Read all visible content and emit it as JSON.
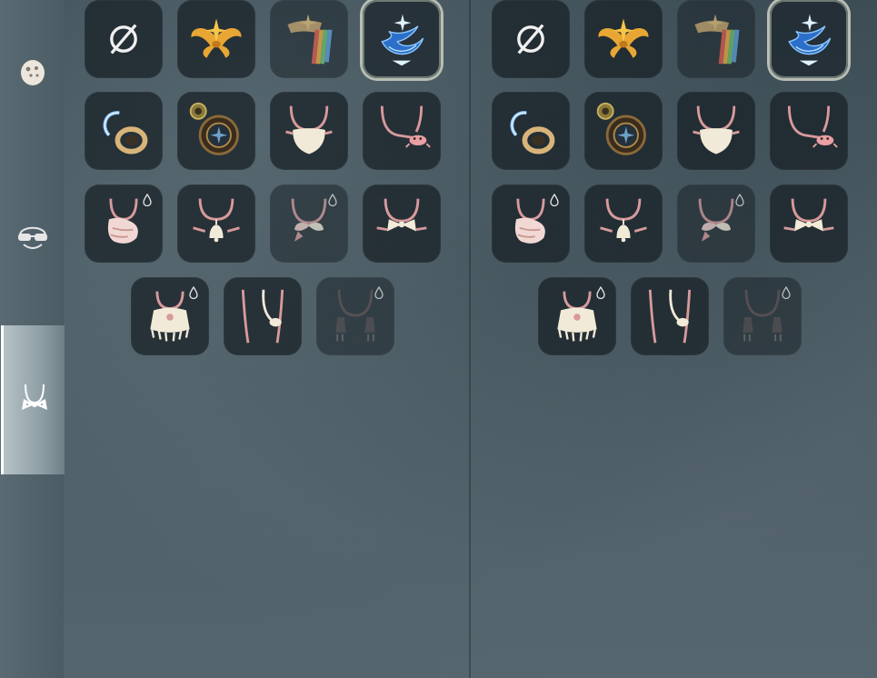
{
  "sidebar": {
    "tabs": [
      {
        "name": "mask-tab",
        "icon": "mask-icon"
      },
      {
        "name": "glasses-tab",
        "icon": "glasses-icon"
      },
      {
        "name": "neck-accessory-tab",
        "icon": "bowtie-necklace-icon",
        "active": true
      }
    ]
  },
  "panels": [
    {
      "rows": [
        [
          "none-icon",
          "golden-wings-icon",
          "rainbow-cape-icon",
          "blue-bird-icon"
        ],
        [
          "glowing-ring-icon",
          "gear-medallion-icon",
          "beard-necklace-icon",
          "crab-necklace-icon"
        ],
        [
          "scarf-necklace-icon",
          "bell-necklace-icon",
          "bow-necklace-icon",
          "bowtie-necklace-icon"
        ],
        [
          "poncho-necklace-icon",
          "long-necklace-icon",
          "dark-tassel-necklace-icon"
        ]
      ],
      "selected": "blue-bird-icon"
    },
    {
      "rows": [
        [
          "none-icon",
          "golden-wings-icon",
          "rainbow-cape-icon",
          "blue-bird-icon"
        ],
        [
          "glowing-ring-icon",
          "gear-medallion-icon",
          "beard-necklace-icon",
          "crab-necklace-icon"
        ],
        [
          "scarf-necklace-icon",
          "bell-necklace-icon",
          "bow-necklace-icon",
          "bowtie-necklace-icon"
        ],
        [
          "poncho-necklace-icon",
          "long-necklace-icon",
          "dark-tassel-necklace-icon"
        ]
      ],
      "selected": "blue-bird-icon"
    }
  ],
  "colors": {
    "slot_bg": "#1a2328",
    "necklace_cord": "#d89a9c",
    "gold": "#e8a634",
    "blue_glow": "#5aa8f0",
    "cream": "#f2ead8"
  }
}
